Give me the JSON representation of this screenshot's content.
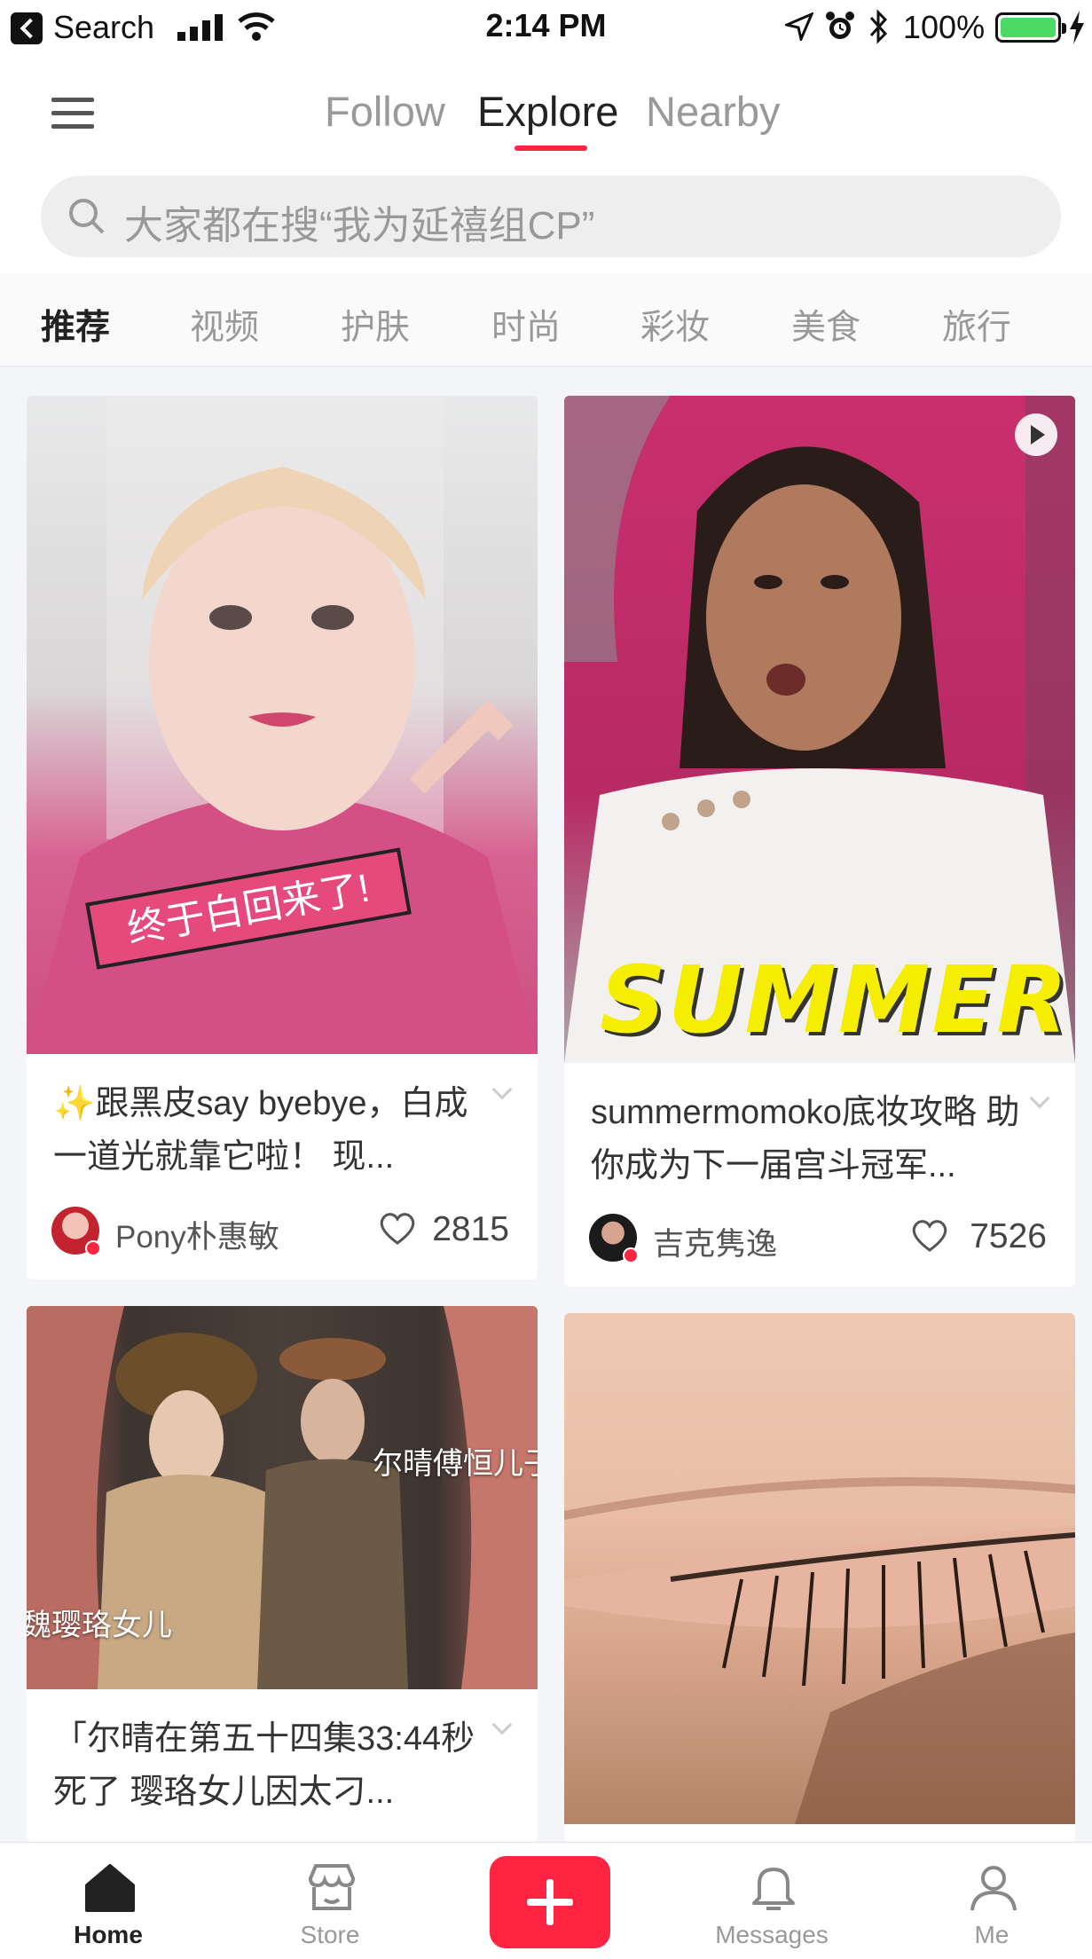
{
  "status_bar": {
    "back_label": "Search",
    "time": "2:14 PM",
    "battery_percent": "100%",
    "battery_level": 1.0
  },
  "header": {
    "tabs": [
      "Follow",
      "Explore",
      "Nearby"
    ],
    "active_tab": "Explore",
    "search_placeholder": "大家都在搜“我为延禧组CP”"
  },
  "categories": {
    "items": [
      "推荐",
      "视频",
      "护肤",
      "时尚",
      "彩妆",
      "美食",
      "旅行"
    ],
    "active": "推荐"
  },
  "feed": [
    {
      "title": "✨跟黑皮say byebye，白成一道光就靠它啦！ 现...",
      "image_caption": "终于白回来了!",
      "author": "Pony朴惠敏",
      "likes": "2815"
    },
    {
      "title": "summermomoko底妆攻略 助你成为下一届宫斗冠军...",
      "image_caption": "SUMMER",
      "author": "吉克隽逸",
      "likes": "7526",
      "is_video": true
    },
    {
      "title": "「尔晴在第五十四集33:44秒死了 璎珞女儿因太刁...",
      "image_caption_1": "尔晴傅恒儿子",
      "image_caption_2": "魏璎珞女儿"
    },
    {
      "title": ""
    }
  ],
  "bottom_nav": {
    "items": [
      "Home",
      "Store",
      "Messages",
      "Me"
    ],
    "active": "Home"
  },
  "colors": {
    "accent": "#ff2442",
    "text_primary": "#222222",
    "text_secondary": "#999999",
    "background": "#f3f5f8"
  }
}
